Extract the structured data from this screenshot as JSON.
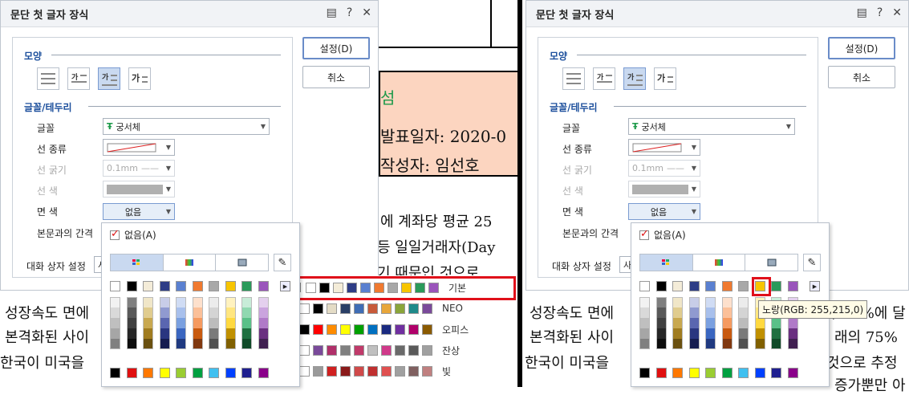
{
  "dialog": {
    "title": "문단 첫 글자 장식",
    "ok_label": "설정(D)",
    "cancel_label": "취소",
    "section_shape": "모양",
    "section_font": "글꼴/테두리",
    "font_label": "글꼴",
    "font_value": "궁서체",
    "line_type_label": "선 종류",
    "line_width_label": "선 굵기",
    "line_width_value": "0.1mm",
    "line_color_label": "선 색",
    "fill_color_label": "면 색",
    "fill_color_value": "없음",
    "spacing_label": "본문과의 간격",
    "dialog_settings_label": "대화 상자 설정",
    "dialog_settings_value": "사"
  },
  "palette": {
    "none_label": "없음(A)",
    "themes": [
      {
        "name": "기본",
        "colors": [
          "#ffffff",
          "#000000",
          "#f4ecd8",
          "#2e3d86",
          "#5a80d0",
          "#f07a30",
          "#a8a8a8",
          "#f7c500",
          "#2a9a5a",
          "#9a55bb"
        ]
      },
      {
        "name": "NEO",
        "colors": [
          "#ffffff",
          "#000000",
          "#e4dcc6",
          "#2a3f66",
          "#3f6db5",
          "#c85a3a",
          "#e8a63a",
          "#8aa53a",
          "#1f8a8a",
          "#7a4a9a"
        ]
      },
      {
        "name": "오피스",
        "colors": [
          "#000000",
          "#ff0000",
          "#ff8c00",
          "#ffff00",
          "#00a000",
          "#0070c0",
          "#1a2a80",
          "#7030a0",
          "#b0006a",
          "#8a5a00"
        ]
      },
      {
        "name": "잔상",
        "colors": [
          "#ffffff",
          "#7a4a9a",
          "#b0306a",
          "#808080",
          "#c03a6a",
          "#c0c0c0",
          "#d03a8a",
          "#6a6a6a",
          "#5a5a5a",
          "#a0a0a0"
        ]
      },
      {
        "name": "빛",
        "colors": [
          "#ffffff",
          "#9a9a9a",
          "#d02020",
          "#8a1a1a",
          "#d04a4a",
          "#c03030",
          "#e05050",
          "#a0a0a0",
          "#806060",
          "#c08080"
        ]
      }
    ],
    "base_colors": [
      "#ffffff",
      "#000000",
      "#f4ecd8",
      "#2e3d86",
      "#5a80d0",
      "#f07a30",
      "#a8a8a8",
      "#f7c500",
      "#2a9a5a",
      "#9a55bb"
    ],
    "shade_columns": [
      [
        "#f2f2f2",
        "#d9d9d9",
        "#bfbfbf",
        "#a6a6a6",
        "#808080"
      ],
      [
        "#7f7f7f",
        "#595959",
        "#404040",
        "#262626",
        "#0d0d0d"
      ],
      [
        "#f0e6c8",
        "#e0cc8f",
        "#c8a850",
        "#a07c20",
        "#6a5010"
      ],
      [
        "#c8cde8",
        "#909ad0",
        "#5a66b0",
        "#2a3680",
        "#151c50"
      ],
      [
        "#d0dcf4",
        "#a8c0ec",
        "#7aa0e0",
        "#3a66c0",
        "#203a80"
      ],
      [
        "#fde0cc",
        "#fbc099",
        "#f59a60",
        "#c85a10",
        "#803810"
      ],
      [
        "#ececec",
        "#d4d4d4",
        "#bcbcbc",
        "#7a7a7a",
        "#505050"
      ],
      [
        "#fff2bf",
        "#ffe680",
        "#ffd940",
        "#c09000",
        "#806000"
      ],
      [
        "#c8ecd8",
        "#90d8b0",
        "#5ac088",
        "#1f7040",
        "#104a28"
      ],
      [
        "#e4d0ee",
        "#caa4de",
        "#b07ac8",
        "#6a3080",
        "#402050"
      ]
    ],
    "standard_colors": [
      "#000000",
      "#e01010",
      "#ff7800",
      "#ffff00",
      "#9acd32",
      "#00a040",
      "#40c0f0",
      "#0040ff",
      "#202090",
      "#8a008a"
    ],
    "tooltip": "노랑(RGB: 255,215,0)"
  },
  "document": {
    "heading_fragment": "섬",
    "date_line": "발표일자: 2020-0",
    "author_line": "작성자: 임선호",
    "line1": "에 계좌당 평균 25",
    "line2": "등 일일거래자(Day",
    "line3": "기 때문인 것으로",
    "line4": "성장속도 면에",
    "line5": "본격화된 사이",
    "line6": "한국이 미국을",
    "right_line4": "/ 20%에 달",
    "right_line5": "래의 75%",
    "right_line6": "것으로 추정",
    "right_line7": "증가뿐만 아"
  }
}
